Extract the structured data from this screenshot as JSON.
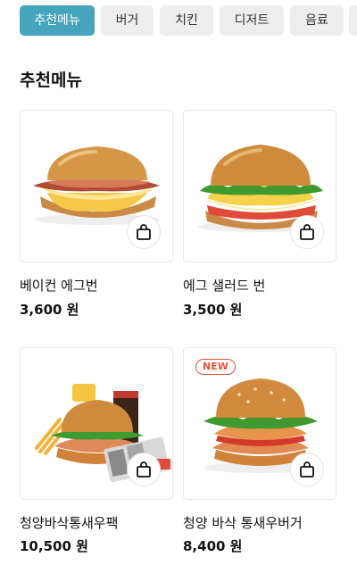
{
  "tabs": [
    {
      "label": "추천메뉴",
      "active": true
    },
    {
      "label": "버거",
      "active": false
    },
    {
      "label": "치킨",
      "active": false
    },
    {
      "label": "디저트",
      "active": false
    },
    {
      "label": "음료",
      "active": false
    }
  ],
  "section_title": "추천메뉴",
  "products": [
    {
      "name": "베이컨 에그번",
      "price": "3,600 원",
      "badge": ""
    },
    {
      "name": "에그 샐러드 번",
      "price": "3,500 원",
      "badge": ""
    },
    {
      "name": "청양바삭통새우팩",
      "price": "10,500 원",
      "badge": ""
    },
    {
      "name": "청양 바삭 통새우버거",
      "price": "8,400 원",
      "badge": "NEW"
    }
  ],
  "icons": {
    "cart": "shopping-bag-icon"
  },
  "colors": {
    "accent": "#45a5bd",
    "badge": "#e0533d"
  }
}
